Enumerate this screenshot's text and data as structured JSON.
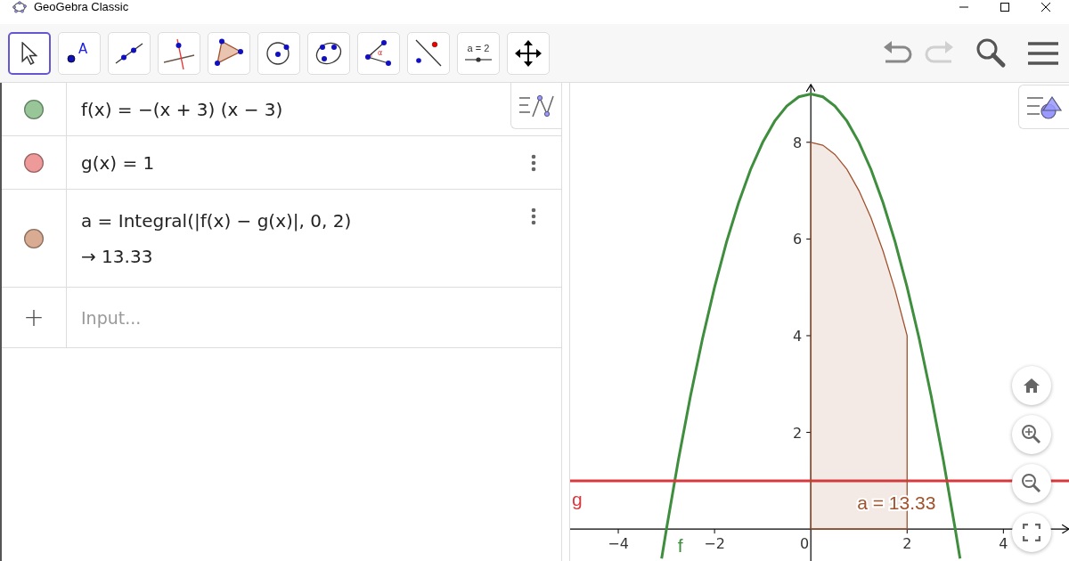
{
  "window": {
    "title": "GeoGebra Classic"
  },
  "toolbar": {
    "tools": [
      {
        "kind": "move",
        "selected": true
      },
      {
        "kind": "point",
        "selected": false,
        "label": "A"
      },
      {
        "kind": "line",
        "selected": false
      },
      {
        "kind": "perpendicular",
        "selected": false
      },
      {
        "kind": "polygon",
        "selected": false
      },
      {
        "kind": "circle",
        "selected": false
      },
      {
        "kind": "conic",
        "selected": false
      },
      {
        "kind": "angle",
        "selected": false,
        "label": "α"
      },
      {
        "kind": "reflect",
        "selected": false
      },
      {
        "kind": "slider",
        "selected": false,
        "label": "a = 2"
      },
      {
        "kind": "pan",
        "selected": false
      }
    ],
    "undo": {
      "disabled": false
    },
    "redo": {
      "disabled": true
    }
  },
  "algebra": {
    "rows": [
      {
        "color": "#99c699",
        "expression": "f(x) = −(x + 3) (x − 3)"
      },
      {
        "color": "#ee9a9a",
        "expression": "g(x) = 1"
      },
      {
        "color": "#d8ab92",
        "expression": "a = Integral(|f(x) − g(x)|, 0, 2)",
        "result": "→ 13.33"
      }
    ],
    "input": {
      "icon": "+",
      "placeholder": "Input..."
    }
  },
  "graphics": {
    "chart_data": {
      "type": "line",
      "xlim": [
        -5,
        5.4
      ],
      "ylim": [
        -0.66,
        9.23
      ],
      "xticks": [
        {
          "value": -4,
          "label": "−4"
        },
        {
          "value": -2,
          "label": "−2"
        },
        {
          "value": 0,
          "label": "0"
        },
        {
          "value": 2,
          "label": "2"
        },
        {
          "value": 4,
          "label": "4"
        }
      ],
      "yticks": [
        2,
        4,
        6,
        8
      ],
      "x": [
        -5,
        -4,
        -3.5,
        -3.1,
        -3,
        -2.75,
        -2.5,
        -2.25,
        -2,
        -1.75,
        -1.5,
        -1.25,
        -1,
        -0.75,
        -0.5,
        -0.25,
        0,
        0.25,
        0.5,
        0.75,
        1,
        1.25,
        1.5,
        1.75,
        2,
        2.25,
        2.5,
        2.75,
        3,
        3.1,
        3.5,
        4,
        5.4
      ],
      "series": [
        {
          "name": "f",
          "color": "#3e8e3e",
          "type": "line",
          "values": [
            null,
            null,
            null,
            -0.61,
            0,
            1.44,
            2.75,
            3.94,
            5,
            5.94,
            6.75,
            7.44,
            8,
            8.44,
            8.75,
            8.94,
            9,
            8.94,
            8.75,
            8.44,
            8,
            7.44,
            6.75,
            5.94,
            5,
            3.94,
            2.75,
            1.44,
            0,
            -0.61,
            null,
            null,
            null
          ]
        },
        {
          "name": "g",
          "color": "#d9383e",
          "type": "line",
          "values": [
            1,
            1,
            1,
            1,
            1,
            1,
            1,
            1,
            1,
            1,
            1,
            1,
            1,
            1,
            1,
            1,
            1,
            1,
            1,
            1,
            1,
            1,
            1,
            1,
            1,
            1,
            1,
            1,
            1,
            1,
            1,
            1,
            1
          ]
        },
        {
          "name": "a = 13.33",
          "color": "#a0522d",
          "type": "area",
          "values": [
            null,
            null,
            null,
            null,
            null,
            null,
            null,
            null,
            null,
            null,
            null,
            null,
            null,
            null,
            null,
            null,
            8,
            7.94,
            7.75,
            7.44,
            7,
            6.44,
            5.75,
            4.94,
            4,
            null,
            null,
            null,
            null,
            null,
            null,
            null,
            null
          ]
        }
      ]
    }
  }
}
